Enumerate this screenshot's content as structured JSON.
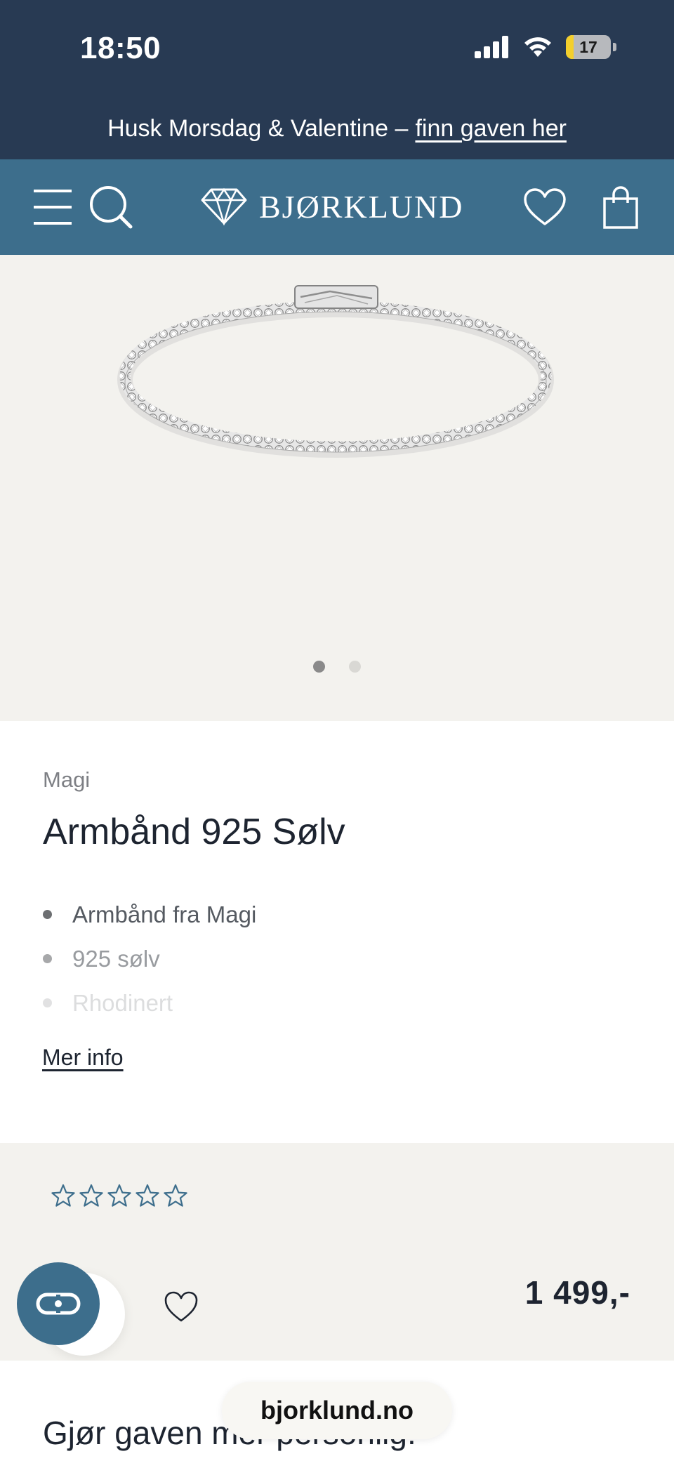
{
  "status_bar": {
    "time": "18:50",
    "battery": "17",
    "battery_level": 0.17,
    "icons": [
      "signal-icon",
      "wifi-icon",
      "battery-icon"
    ]
  },
  "promo": {
    "text": "Husk Morsdag & Valentine –",
    "link": "finn gaven her"
  },
  "nav": {
    "logo": "BJØRKLUND",
    "icons": [
      "menu-icon",
      "search-icon",
      "diamond-logo-icon",
      "heart-icon",
      "bag-icon"
    ]
  },
  "gallery": {
    "image": "tennis-bracelet-silver",
    "slides": 2,
    "active_slide": 1
  },
  "product": {
    "brand": "Magi",
    "title": "Armbånd 925 Sølv",
    "features": [
      "Armbånd fra Magi",
      "925 sølv",
      "Rhodinert"
    ],
    "more_info": "Mer info"
  },
  "purchase": {
    "rating": 0,
    "rating_max": 5,
    "price": "1 499,-"
  },
  "gift": {
    "title": "Gjør gaven mer personlig:"
  },
  "browser": {
    "url": "bjorklund.no"
  },
  "colors": {
    "header": "#283a53",
    "nav": "#3d6e8c",
    "page_bg": "#f3f2ee"
  }
}
